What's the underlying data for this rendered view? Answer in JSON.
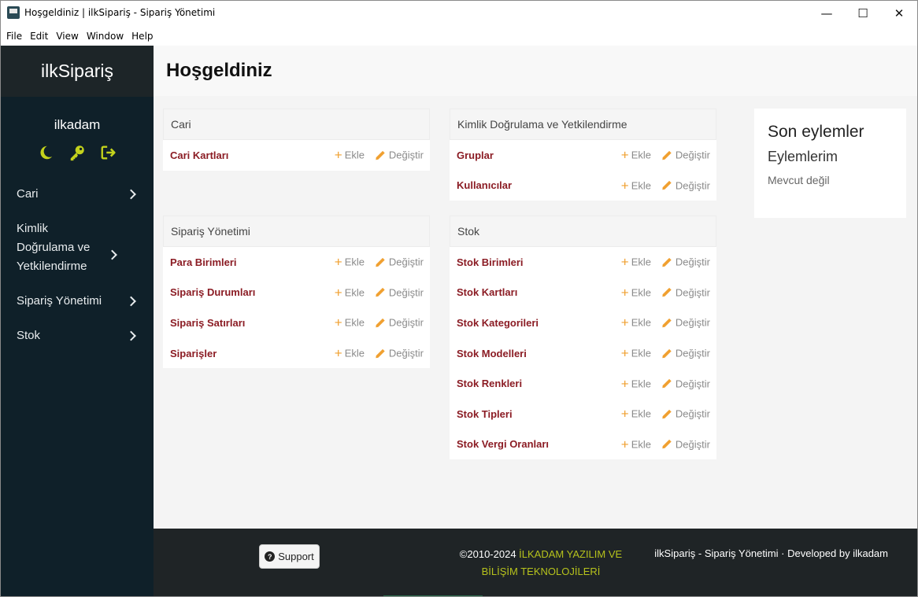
{
  "window": {
    "title": "Hoşgeldiniz | ilkSipariş - Sipariş Yönetimi",
    "controls": {
      "minimize": "—",
      "maximize": "☐",
      "close": "✕"
    }
  },
  "menubar": [
    "File",
    "Edit",
    "View",
    "Window",
    "Help"
  ],
  "sidebar": {
    "brand": "ilkSipariş",
    "username": "ilkadam",
    "icons": [
      "moon-icon",
      "key-icon",
      "logout-icon"
    ],
    "accent_color": "#c3d21c",
    "items": [
      {
        "label": "Cari"
      },
      {
        "label": "Kimlik Doğrulama ve Yetkilendirme"
      },
      {
        "label": "Sipariş Yönetimi"
      },
      {
        "label": "Stok"
      }
    ]
  },
  "page": {
    "title": "Hoşgeldiniz"
  },
  "actions": {
    "add": "Ekle",
    "edit": "Değiştir"
  },
  "cards": {
    "cari": {
      "title": "Cari",
      "rows": [
        "Cari Kartları"
      ]
    },
    "kimlik": {
      "title": "Kimlik Doğrulama ve Yetkilendirme",
      "rows": [
        "Gruplar",
        "Kullanıcılar"
      ]
    },
    "siparis": {
      "title": "Sipariş Yönetimi",
      "rows": [
        "Para Birimleri",
        "Sipariş Durumları",
        "Sipariş Satırları",
        "Siparişler"
      ]
    },
    "stok": {
      "title": "Stok",
      "rows": [
        "Stok Birimleri",
        "Stok Kartları",
        "Stok Kategorileri",
        "Stok Modelleri",
        "Stok Renkleri",
        "Stok Tipleri",
        "Stok Vergi Oranları"
      ]
    }
  },
  "recent_actions": {
    "title": "Son eylemler",
    "subtitle": "Eylemlerim",
    "empty": "Mevcut değil"
  },
  "footer": {
    "support": "Support",
    "copyright": "©2010-2024",
    "company": "İLKADAM YAZILIM VE BİLİŞİM TEKNOLOJİLERİ",
    "developed": "ilkSipariş - Sipariş Yönetimi · Developed by ilkadam"
  },
  "colors": {
    "link": "#8b1c24",
    "add_icon": "#f0a030",
    "sidebar_bg": "#0f2029",
    "footer_bg": "#1f2426"
  }
}
